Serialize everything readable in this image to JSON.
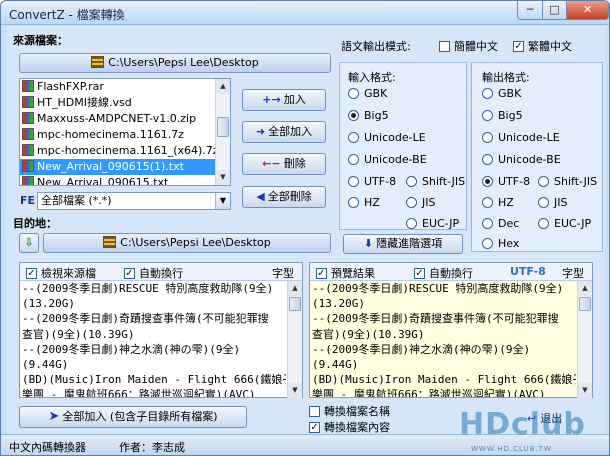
{
  "window": {
    "title": "ConvertZ - 檔案轉換",
    "min_label": "─",
    "max_label": "□",
    "close_label": "✕"
  },
  "source": {
    "label": "來源檔案：",
    "path": "C:\\Users\\Pepsi Lee\\Desktop",
    "files": [
      {
        "name": "FlashFXP.rar",
        "selected": false
      },
      {
        "name": "HT_HDMI接線.vsd",
        "selected": false
      },
      {
        "name": "Maxxuss-AMDPCNET-v1.0.zip",
        "selected": false
      },
      {
        "name": "mpc-homecinema.1161.7z",
        "selected": false
      },
      {
        "name": "mpc-homecinema.1161_(x64).7z",
        "selected": false
      },
      {
        "name": "New_Arrival_090615(1).txt",
        "selected": true
      },
      {
        "name": "New_Arrival_090615.txt",
        "selected": false
      }
    ],
    "filter_badge": "FE",
    "filter_value": "全部檔案 (*.*)"
  },
  "actions": {
    "add": "加入",
    "add_all": "全部加入",
    "remove": "刪除",
    "remove_all": "全部刪除"
  },
  "destination": {
    "label": "目的地：",
    "path": "C:\\Users\\Pepsi Lee\\Desktop"
  },
  "output_mode": {
    "label": "語文輸出模式:",
    "simplified": "簡體中文",
    "simplified_checked": false,
    "traditional": "繁體中文",
    "traditional_checked": true
  },
  "input_format": {
    "label": "輸入格式:",
    "options": [
      "GBK",
      "Big5",
      "Unicode-LE",
      "Unicode-BE",
      "UTF-8",
      "Shift-JIS",
      "HZ",
      "JIS",
      "EUC-JP"
    ],
    "selected": "Big5"
  },
  "output_format": {
    "label": "輸出格式:",
    "options": [
      "GBK",
      "Big5",
      "Unicode-LE",
      "Unicode-BE",
      "UTF-8",
      "Shift-JIS",
      "HZ",
      "JIS",
      "Dec",
      "EUC-JP",
      "Hex"
    ],
    "selected": "UTF-8"
  },
  "hide_advanced": "隱藏進階選項",
  "left_view": {
    "view_source": "檢視來源檔",
    "view_source_checked": true,
    "wrap": "自動換行",
    "wrap_checked": true,
    "font": "字型",
    "lines": [
      "--(2009冬季日劇)RESCUE 特別高度救助隊(9全)",
      "(13.20G)",
      "--(2009冬季日劇)奇蹟搜查事件簿(不可能犯罪搜",
      "查官)(9全)(10.39G)",
      "--(2009冬季日劇)神之水滴(神の雫)(9全)",
      "(9.44G)",
      "(BD)(Music)Iron Maiden - Flight 666(鐵娘子",
      "樂團 - 魔鬼航班666：路滅世巡迴紀實)(AVC)"
    ]
  },
  "right_view": {
    "preview": "預覽結果",
    "preview_checked": true,
    "wrap": "自動換行",
    "wrap_checked": true,
    "encoding": "UTF-8",
    "font": "字型",
    "lines": [
      "--(2009冬季日劇)RESCUE 特別高度救助隊(9全)",
      "(13.20G)",
      "--(2009冬季日劇)奇蹟搜查事件簿(不可能犯罪搜",
      "查官)(9全)(10.39G)",
      "--(2009冬季日劇)神之水滴(神の雫)(9全)",
      "(9.44G)",
      "(BD)(Music)Iron Maiden - Flight 666(鐵娘子",
      "樂團 - 魔鬼航班666：路滅世巡迴紀實)(AVC)"
    ]
  },
  "bottom": {
    "add_all_recursive": "全部加入 (包含子目錄所有檔案)",
    "convert_filename": "轉換檔案名稱",
    "convert_filename_checked": false,
    "convert_content": "轉換檔案內容",
    "convert_content_checked": true,
    "exit": "退出"
  },
  "status": {
    "left": "中文內碼轉換器",
    "author": "作者：李志成"
  },
  "watermark": {
    "big": "HDclub",
    "small": "WWW.HD.CLUB.TW"
  },
  "colors": {
    "accent_blue": "#1a3ab0",
    "selection": "#3399ff",
    "utf8_label": "#2a6fbf"
  }
}
